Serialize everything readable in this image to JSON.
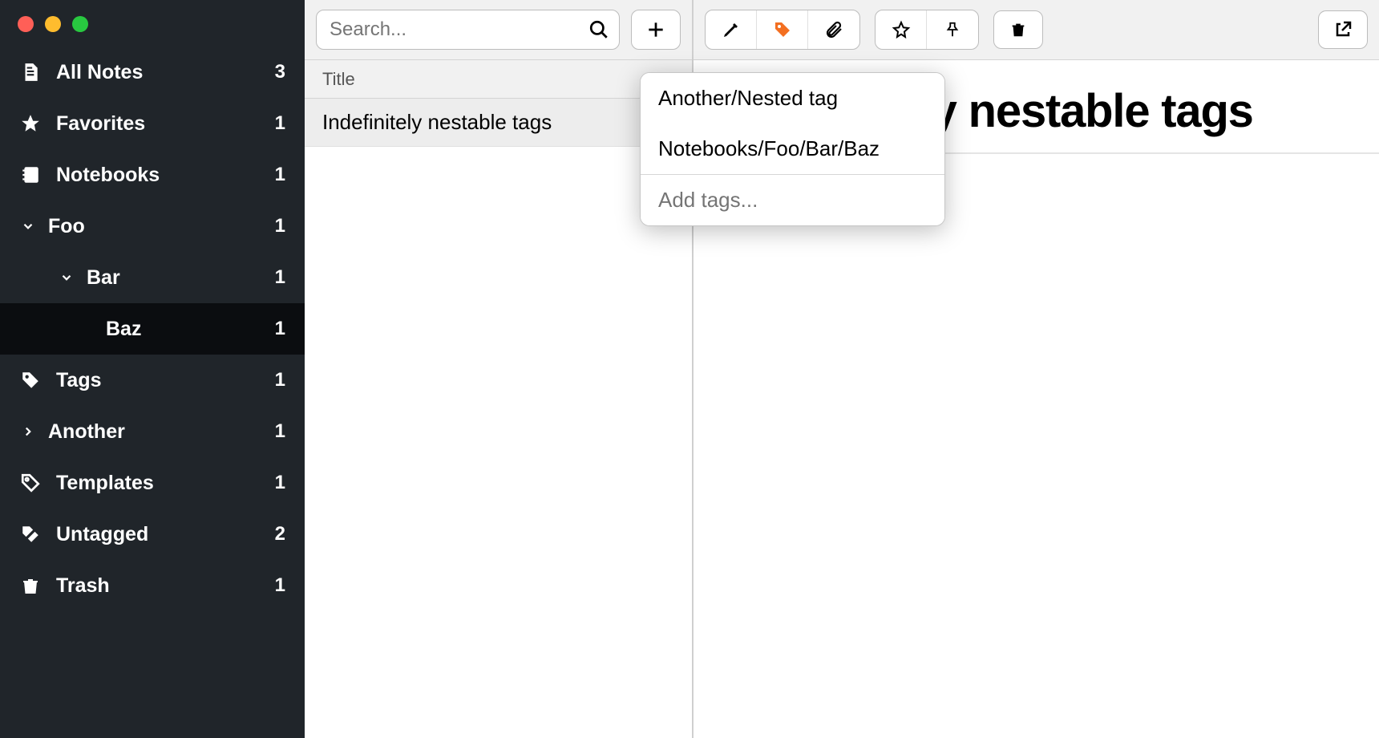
{
  "sidebar": {
    "items": [
      {
        "icon": "note-icon",
        "label": "All Notes",
        "count": "3"
      },
      {
        "icon": "star-icon",
        "label": "Favorites",
        "count": "1"
      },
      {
        "icon": "notebook-icon",
        "label": "Notebooks",
        "count": "1"
      },
      {
        "icon": "chevron-down-icon",
        "label": "Foo",
        "count": "1"
      },
      {
        "icon": "chevron-down-icon",
        "label": "Bar",
        "count": "1"
      },
      {
        "icon": "",
        "label": "Baz",
        "count": "1",
        "selected": true
      },
      {
        "icon": "tag-icon",
        "label": "Tags",
        "count": "1"
      },
      {
        "icon": "chevron-right-icon",
        "label": "Another",
        "count": "1"
      },
      {
        "icon": "template-icon",
        "label": "Templates",
        "count": "1"
      },
      {
        "icon": "untagged-icon",
        "label": "Untagged",
        "count": "2"
      },
      {
        "icon": "trash-icon",
        "label": "Trash",
        "count": "1"
      }
    ]
  },
  "search": {
    "placeholder": "Search..."
  },
  "list": {
    "header": "Title",
    "notes": [
      {
        "title": "Indefinitely nestable tags",
        "selected": true
      }
    ]
  },
  "editor": {
    "title": "Indefinitely nestable tags"
  },
  "popover": {
    "tags": [
      "Another/Nested tag",
      "Notebooks/Foo/Bar/Baz"
    ],
    "add_placeholder": "Add tags..."
  },
  "colors": {
    "tag_active": "#f36f21"
  }
}
